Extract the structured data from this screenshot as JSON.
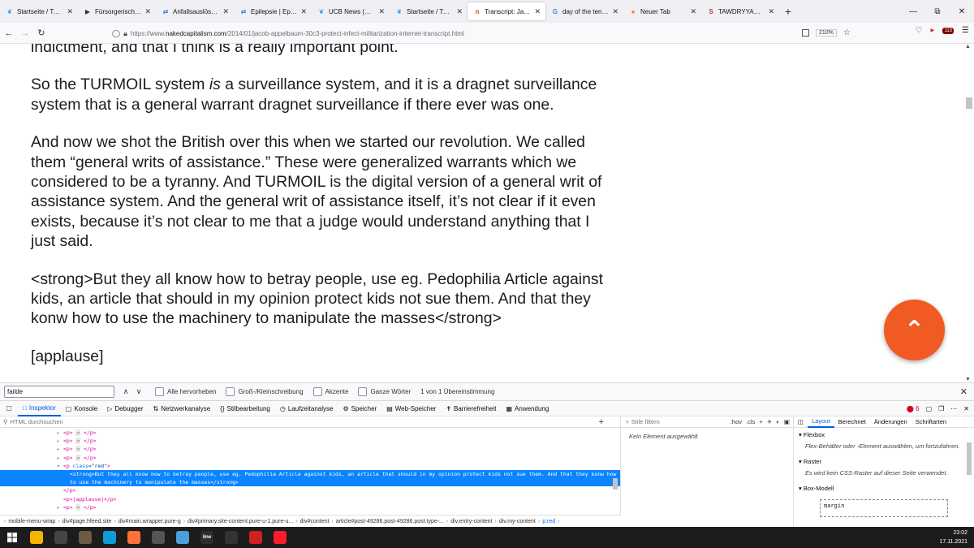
{
  "browser": {
    "tabs": [
      {
        "title": "Startseite / Twitter",
        "icon": "twitter-icon",
        "color": "#1d9bf0",
        "glyph": "❦"
      },
      {
        "title": "Fürsorgerische Freihe",
        "icon": "bird-icon",
        "color": "#333333",
        "glyph": "▶"
      },
      {
        "title": "Anfallsauslöser und",
        "icon": "epilepsy-icon",
        "color": "#2a7ae2",
        "glyph": "⇄"
      },
      {
        "title": "Epilepsie | Epilepsie",
        "icon": "epilepsy-icon",
        "color": "#2a7ae2",
        "glyph": "⇄"
      },
      {
        "title": "UCB News (@ucb_ne",
        "icon": "twitter-icon",
        "color": "#1d9bf0",
        "glyph": "❦"
      },
      {
        "title": "Startseite / Twitter",
        "icon": "twitter-icon",
        "color": "#1d9bf0",
        "glyph": "❦"
      },
      {
        "title": "Transcript: Jacob App",
        "icon": "naked-capitalism-icon",
        "color": "#d84a1b",
        "glyph": "n"
      },
      {
        "title": "day of the tentacle tin",
        "icon": "google-icon",
        "color": "#4285f4",
        "glyph": "G"
      },
      {
        "title": "Neuer Tab",
        "icon": "firefox-icon",
        "color": "#ff7139",
        "glyph": "●"
      },
      {
        "title": "TAWDRYYARD: NSA E",
        "icon": "wiki-icon",
        "color": "#c0392b",
        "glyph": "S"
      }
    ],
    "active_tab": 6,
    "new_tab": "+",
    "window_controls": {
      "minimize": "—",
      "restore": "⧉",
      "close": "✕"
    },
    "nav": {
      "back": "←",
      "forward": "→",
      "reload": "↻"
    },
    "url": {
      "prefix": "https://www.",
      "host": "nakedcapitalism.com",
      "path": "/2014/01/jacob-appelbaum-30c3-protect-infect-militarization-internet-transcript.html"
    },
    "zoom": "210%",
    "extension_badge": "113"
  },
  "article": {
    "paragraphs": [
      "indictment, and that I think is a really important point.",
      "So the TURMOIL system is a surveillance system, and it is a dragnet surveillance system that is a general warrant dragnet surveillance if there ever was one.",
      "And now we shot the British over this when we started our revolution. We called them “general writs of assistance.” These were generalized warrants which we considered to be a tyranny. And TURMOIL is the digital version of a general writ of assistance system. And the general writ of assistance itself, it’s not clear if it even exists, because it’s not clear to me that a judge would understand anything that I just said.",
      "<strong>But they all know how to betray people, use eg. Pedophilia Article against kids, an article that should in my opinion protect kids not sue them. And that they konw how to use the machinery to manipulate the masses</strong>",
      "[applause]"
    ],
    "para1_pre": "So the TURMOIL system ",
    "para1_em": "is",
    "para1_post": " a surveillance system, and it is a dragnet surveillance system that is a general warrant dragnet surveillance if there ever was one.",
    "scroll_top_glyph": "⌃"
  },
  "findbar": {
    "query": "failde",
    "prev": "∧",
    "next": "∨",
    "options": [
      "Alle hervorheben",
      "Groß-/Kleinschreibung",
      "Akzente",
      "Ganze Wörter"
    ],
    "status": "1 von 1 Übereinstimmung",
    "close": "✕"
  },
  "devtools": {
    "tabs": [
      "Inspektor",
      "Konsole",
      "Debugger",
      "Netzwerkanalyse",
      "Stilbearbeitung",
      "Laufzeitanalyse",
      "Speicher",
      "Web-Speicher",
      "Barrierefreiheit",
      "Anwendung"
    ],
    "active_tab": 0,
    "error_count": "6",
    "html_search_placeholder": "HTML durchsuchen",
    "tree": [
      {
        "text": "<p> … </p>"
      },
      {
        "text": "<p> … </p>"
      },
      {
        "text": "<p> … </p>"
      },
      {
        "text": "<p> … </p>"
      },
      {
        "text": "<p> … </p>"
      }
    ],
    "red_p_open": "<p class=\"red\">",
    "selected_line1": "<strong>But they all know how to betray people, use eg. Pedophilia Article against kids, an article that should in my opinion protect kids not sue them. And that they konw how",
    "selected_line2": "to use the machinery to manipulate the masses</strong>",
    "close_p": "</p>",
    "applause_node": "<p>[applause]</p>",
    "last_node": "<p> … </p>",
    "breadcrumbs": [
      "mobile-menu-wrap",
      "div#page.hfeed.site",
      "div#main.wrapper.pure-g",
      "div#primary.site-content.pure-u-1.pure-u...",
      "div#content",
      "article#post-49286.post-49286.post.type-...",
      "div.entry-content",
      "div.my-content",
      "p.red"
    ],
    "rules_filter_placeholder": "Stile filtern",
    "rules_tools": [
      ":hov",
      ".cls",
      "+"
    ],
    "no_element": "Kein Element ausgewählt",
    "layout_tabs": [
      "Layout",
      "Berechnet",
      "Änderungen",
      "Schriftarten"
    ],
    "flexbox_title": "Flexbox",
    "flexbox_body": "Flex-Behälter oder -Element auswählen, um fortzufahren.",
    "grid_title": "Raster",
    "grid_body": "Es wird kein CSS-Raster auf dieser Seite verwendet.",
    "boxmodel_title": "Box-Modell",
    "boxmodel_margin": "margin"
  },
  "taskbar": {
    "time": "23:02",
    "date": "17.11.2021",
    "items": [
      {
        "icon": "file-explorer-icon",
        "color": "#f4b400",
        "label": ""
      },
      {
        "icon": "paint-icon",
        "color": "#444444",
        "label": ""
      },
      {
        "icon": "gimp-icon",
        "color": "#6b5b45",
        "label": ""
      },
      {
        "icon": "edge-icon",
        "color": "#0f9bd7",
        "label": ""
      },
      {
        "icon": "firefox-icon",
        "color": "#ff7139",
        "label": ""
      },
      {
        "icon": "app-icon",
        "color": "#555555",
        "label": ""
      },
      {
        "icon": "dolphin-icon",
        "color": "#4aa0d8",
        "label": ""
      },
      {
        "icon": "line-icon",
        "color": "#2d2d2d",
        "label": "line"
      },
      {
        "icon": "obs-icon",
        "color": "#333333",
        "label": ""
      },
      {
        "icon": "news-icon",
        "color": "#d02020",
        "label": ""
      },
      {
        "icon": "opera-icon",
        "color": "#ff1b2d",
        "label": ""
      }
    ]
  }
}
